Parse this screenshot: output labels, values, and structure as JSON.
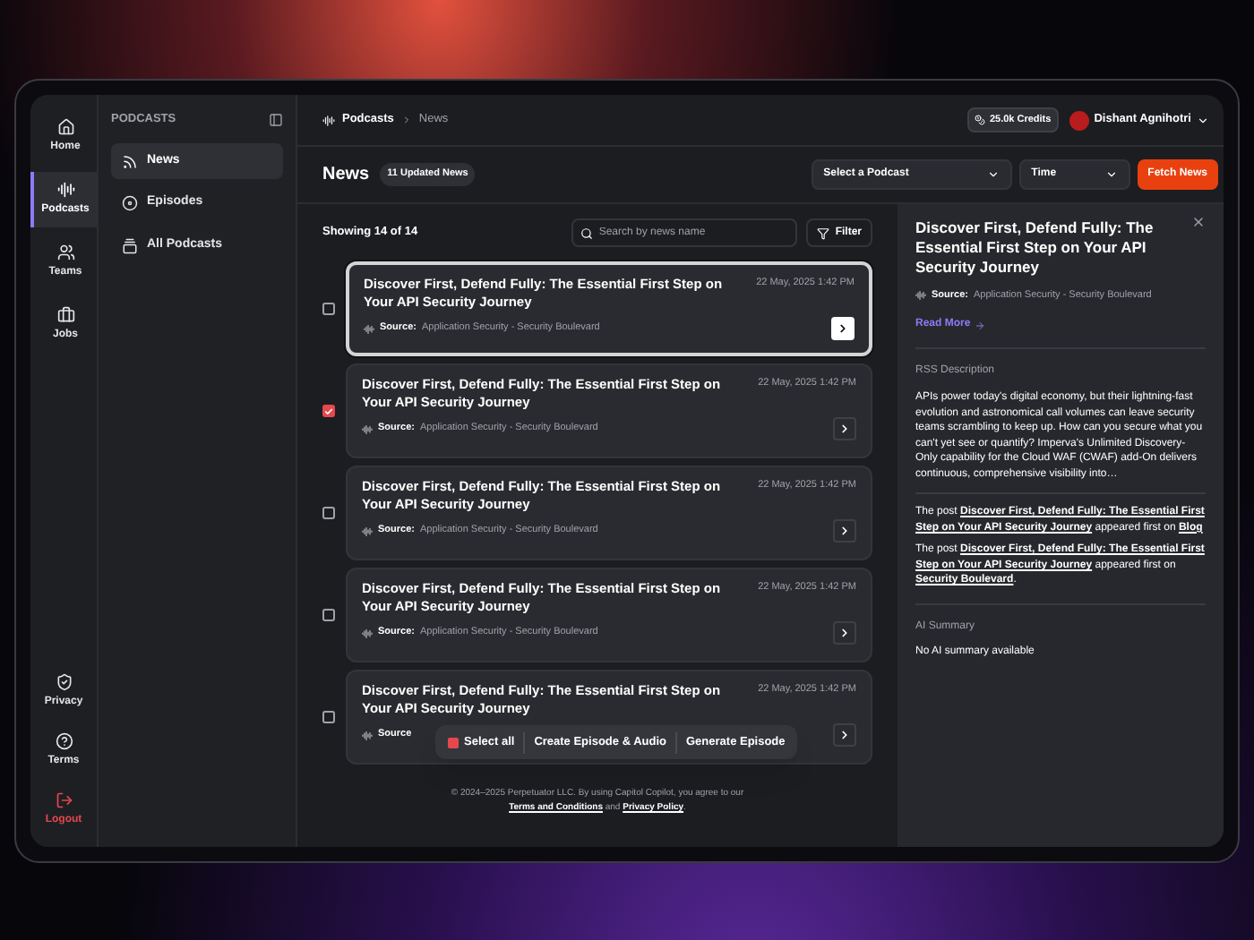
{
  "rail": {
    "top": [
      {
        "label": "Home",
        "selected": false
      },
      {
        "label": "Podcasts",
        "selected": true
      },
      {
        "label": "Teams",
        "selected": false
      },
      {
        "label": "Jobs",
        "selected": false
      }
    ],
    "bottom": [
      {
        "label": "Privacy",
        "kind": "normal"
      },
      {
        "label": "Terms",
        "kind": "normal"
      },
      {
        "label": "Logout",
        "kind": "danger"
      }
    ]
  },
  "sidebar": {
    "title": "PODCASTS",
    "items": [
      {
        "label": "News",
        "selected": true
      },
      {
        "label": "Episodes",
        "selected": false
      },
      {
        "label": "All Podcasts",
        "selected": false
      }
    ]
  },
  "breadcrumb": [
    "Podcasts",
    "News"
  ],
  "credits": "25.0k Credits",
  "user": {
    "name": "Dishant Agnihotri"
  },
  "header": {
    "title": "News",
    "badge": "11 Updated News",
    "podcast_select": {
      "placeholder": "Select a Podcast"
    },
    "time_select": {
      "placeholder": "Time"
    },
    "fetch_button": "Fetch News"
  },
  "list": {
    "count": "Showing 14 of 14",
    "search": {
      "placeholder": "Search by news name"
    },
    "filter": "Filter",
    "items": [
      {
        "title": "Discover First, Defend Fully: The Essential First Step on Your API Security Journey",
        "date": "22 May, 2025 1:42 PM",
        "source_label": "Source:",
        "source": "Application Security - Security Boulevard",
        "checked": false,
        "selected": true
      },
      {
        "title": "Discover First, Defend Fully: The Essential First Step on Your API Security Journey",
        "date": "22 May, 2025 1:42 PM",
        "source_label": "Source:",
        "source": "Application Security - Security Boulevard",
        "checked": true,
        "selected": false
      },
      {
        "title": "Discover First, Defend Fully: The Essential First Step on Your API Security Journey",
        "date": "22 May, 2025 1:42 PM",
        "source_label": "Source:",
        "source": "Application Security - Security Boulevard",
        "checked": false,
        "selected": false
      },
      {
        "title": "Discover First, Defend Fully: The Essential First Step on Your API Security Journey",
        "date": "22 May, 2025 1:42 PM",
        "source_label": "Source:",
        "source": "Application Security - Security Boulevard",
        "checked": false,
        "selected": false
      },
      {
        "title": "Discover First, Defend Fully: The Essential First Step on Your API Security Journey",
        "date": "22 May, 2025 1:42 PM",
        "source_label": "Source",
        "checked": false,
        "selected": false
      }
    ]
  },
  "bulk_bar": {
    "select_all": "Select all",
    "indeterminate": true,
    "actions": [
      "Create Episode & Audio",
      "Generate Episode"
    ]
  },
  "footer": {
    "text": "© 2024–2025 Perpetuator LLC. By using Capitol Copilot, you agree to our",
    "terms": "Terms and Conditions",
    "and": "and",
    "privacy": "Privacy Policy",
    "end": "."
  },
  "detail": {
    "title": "Discover First, Defend Fully: The Essential First Step on Your API Security Journey",
    "source_label": "Source:",
    "source": "Application Security - Security Boulevard",
    "read_more": "Read More",
    "rss_heading": "RSS Description",
    "rss_description": "APIs power today's digital economy, but their lightning-fast evolution and astronomical call volumes can leave security teams scrambling to keep up. How can you secure what you can't yet see or quantify? Imperva's Unlimited Discovery-Only capability for the Cloud WAF (CWAF) add-On delivers continuous, comprehensive visibility into…",
    "posts": [
      {
        "before": "The post",
        "link": "Discover First, Defend Fully: The Essential First Step on Your API Security Journey",
        "middle": "appeared first on",
        "target": "Blog"
      },
      {
        "before": "The post",
        "link": "Discover First, Defend Fully: The Essential First Step on Your API Security Journey",
        "middle": "appeared first on",
        "target": "Security Boulevard",
        "end": "."
      }
    ],
    "ai_heading": "AI Summary",
    "ai_summary": "No AI summary available"
  }
}
